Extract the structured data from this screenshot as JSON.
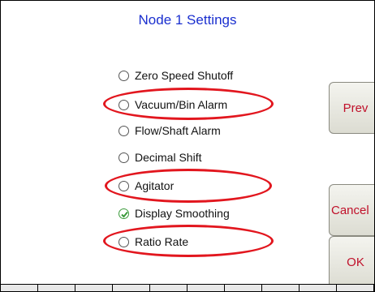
{
  "title": "Node 1 Settings",
  "options": [
    {
      "label": "Zero Speed Shutoff",
      "checked": false
    },
    {
      "label": "Vacuum/Bin Alarm",
      "checked": false
    },
    {
      "label": "Flow/Shaft Alarm",
      "checked": false
    },
    {
      "label": "Decimal Shift",
      "checked": false
    },
    {
      "label": "Agitator",
      "checked": false
    },
    {
      "label": "Display Smoothing",
      "checked": true
    },
    {
      "label": "Ratio Rate",
      "checked": false
    }
  ],
  "buttons": {
    "prev": "Prev",
    "cancel": "Cancel",
    "ok": "OK"
  },
  "colors": {
    "title": "#1a2fcf",
    "button_text": "#c0102a",
    "highlight": "#e2161e",
    "check": "#3a9a3a"
  }
}
